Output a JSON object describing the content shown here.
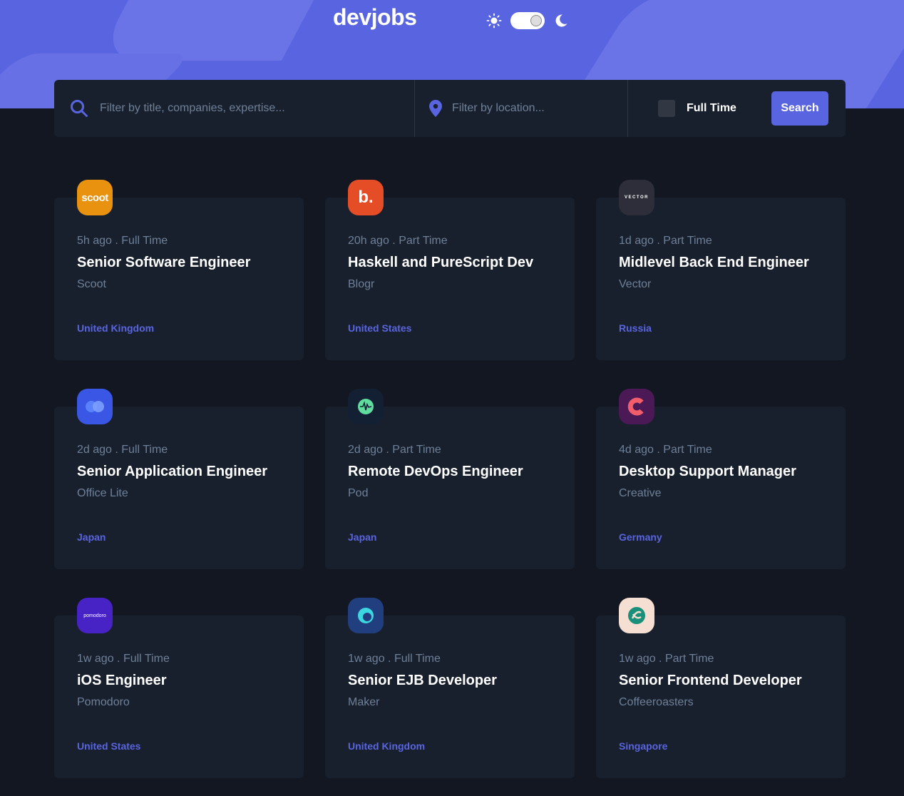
{
  "header": {
    "logo": "devjobs",
    "theme_icons": {
      "light": "sun-icon",
      "dark": "moon-icon"
    }
  },
  "filter": {
    "title_placeholder": "Filter by title, companies, expertise...",
    "location_placeholder": "Filter by location...",
    "fulltime_label": "Full Time",
    "search_label": "Search"
  },
  "colors": {
    "accent": "#5964e0",
    "background": "#121721",
    "card": "#19202d",
    "muted": "#6e8098"
  },
  "jobs": [
    {
      "posted": "5h ago",
      "contract": "Full Time",
      "position": "Senior Software Engineer",
      "company": "Scoot",
      "location": "United Kingdom",
      "logo_text": "scoot",
      "logo_bg": "#e99210"
    },
    {
      "posted": "20h ago",
      "contract": "Part Time",
      "position": "Haskell and PureScript Dev",
      "company": "Blogr",
      "location": "United States",
      "logo_text": "b.",
      "logo_bg": "#e54d26"
    },
    {
      "posted": "1d ago",
      "contract": "Part Time",
      "position": "Midlevel Back End Engineer",
      "company": "Vector",
      "location": "Russia",
      "logo_text": "VECTOR",
      "logo_bg": "#2e2e3a"
    },
    {
      "posted": "2d ago",
      "contract": "Full Time",
      "position": "Senior Application Engineer",
      "company": "Office Lite",
      "location": "Japan",
      "logo_text": "",
      "logo_bg": "#3a56e4"
    },
    {
      "posted": "2d ago",
      "contract": "Part Time",
      "position": "Remote DevOps Engineer",
      "company": "Pod",
      "location": "Japan",
      "logo_text": "",
      "logo_bg": "#132034"
    },
    {
      "posted": "4d ago",
      "contract": "Part Time",
      "position": "Desktop Support Manager",
      "company": "Creative",
      "location": "Germany",
      "logo_text": "",
      "logo_bg": "#4b1955"
    },
    {
      "posted": "1w ago",
      "contract": "Full Time",
      "position": "iOS Engineer",
      "company": "Pomodoro",
      "location": "United States",
      "logo_text": "pomodoro",
      "logo_bg": "#4722c4"
    },
    {
      "posted": "1w ago",
      "contract": "Full Time",
      "position": "Senior EJB Developer",
      "company": "Maker",
      "location": "United Kingdom",
      "logo_text": "",
      "logo_bg": "#213f7f"
    },
    {
      "posted": "1w ago",
      "contract": "Part Time",
      "position": "Senior Frontend Developer",
      "company": "Coffeeroasters",
      "location": "Singapore",
      "logo_text": "",
      "logo_bg": "#f4dfd2"
    }
  ]
}
